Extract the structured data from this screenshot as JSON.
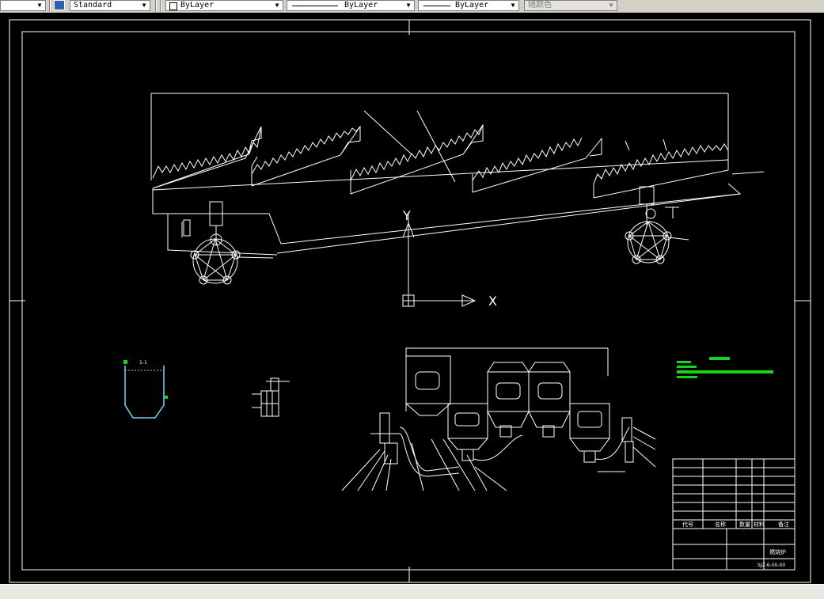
{
  "toolbar": {
    "textstyle": "Standard",
    "layer": "ByLayer",
    "linetype": "ByLayer",
    "lineweight": "ByLayer",
    "color": "随颜色"
  },
  "drawing": {
    "axis_y": "Y",
    "axis_x": "X",
    "section_label": "1-1",
    "title_block_name": "燃烧炉",
    "title_block_header": [
      "代号",
      "名称",
      "数量",
      "材料",
      "备注"
    ],
    "title_block_code": "SJZ-6-00-00"
  },
  "colors": {
    "canvas": "#000000",
    "lines": "#ffffff",
    "cyan": "#6ed8f0",
    "green": "#19d219"
  }
}
